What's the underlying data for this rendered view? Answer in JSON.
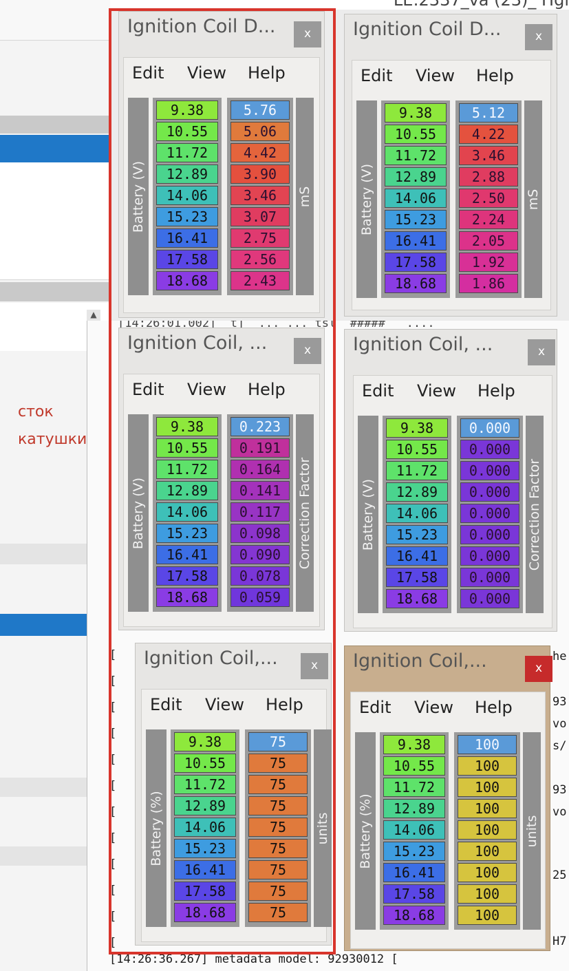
{
  "background": {
    "title_fragment": "LE:2337_va  (23)_ Hgl",
    "annotation_lines": [
      "сток",
      "катушки"
    ],
    "console_lines": [
      "[14:26:01.002]  t]  ... ... tsl  #####   ....",
      "[14:26:36.267] metadata model: 92930012 ["
    ],
    "console_right_fragments": [
      "he",
      "93",
      "vo",
      "s/",
      "93",
      "vo",
      "25",
      "H7"
    ],
    "console_left_marks": [
      "[",
      "[",
      "[",
      "[",
      "[",
      "[",
      "[",
      "[",
      "[",
      "[",
      "[",
      "["
    ]
  },
  "windows": [
    {
      "id": "w1",
      "title": "Ignition Coil D...",
      "close": "x",
      "menu": [
        "Edit",
        "View",
        "Help"
      ],
      "left_axis": "Battery (V)",
      "right_axis": "mS",
      "battery": [
        "9.38",
        "10.55",
        "11.72",
        "12.89",
        "14.06",
        "15.23",
        "16.41",
        "17.58",
        "18.68"
      ],
      "values": [
        "5.76",
        "5.06",
        "4.42",
        "3.90",
        "3.46",
        "3.07",
        "2.75",
        "2.56",
        "2.43"
      ],
      "value_colors": [
        "#5a9ad8",
        "#e07a3c",
        "#e4643c",
        "#e4503e",
        "#e24452",
        "#e03c60",
        "#e03a70",
        "#e0387c",
        "#dc348a"
      ]
    },
    {
      "id": "w2",
      "title": "Ignition Coil D...",
      "close": "x",
      "menu": [
        "Edit",
        "View",
        "Help"
      ],
      "left_axis": "Battery (V)",
      "right_axis": "mS",
      "battery": [
        "9.38",
        "10.55",
        "11.72",
        "12.89",
        "14.06",
        "15.23",
        "16.41",
        "17.58",
        "18.68"
      ],
      "values": [
        "5.12",
        "4.22",
        "3.46",
        "2.88",
        "2.50",
        "2.24",
        "2.05",
        "1.92",
        "1.86"
      ],
      "value_colors": [
        "#5a9ad8",
        "#e4523e",
        "#e2444e",
        "#e03c60",
        "#e0386e",
        "#de347c",
        "#dc328a",
        "#d83096",
        "#d42ea0"
      ]
    },
    {
      "id": "w3",
      "title": "Ignition Coil, ...",
      "close": "x",
      "menu": [
        "Edit",
        "View",
        "Help"
      ],
      "left_axis": "Battery (V)",
      "right_axis": "Correction Factor",
      "battery": [
        "9.38",
        "10.55",
        "11.72",
        "12.89",
        "14.06",
        "15.23",
        "16.41",
        "17.58",
        "18.68"
      ],
      "values": [
        "0.223",
        "0.191",
        "0.164",
        "0.141",
        "0.117",
        "0.098",
        "0.090",
        "0.078",
        "0.059"
      ],
      "value_colors": [
        "#5a9ad8",
        "#c0309c",
        "#b030b0",
        "#a432bc",
        "#9834c4",
        "#8c34cc",
        "#8436d2",
        "#7a36d8",
        "#7036dc"
      ]
    },
    {
      "id": "w4",
      "title": "Ignition Coil, ...",
      "close": "x",
      "menu": [
        "Edit",
        "View",
        "Help"
      ],
      "left_axis": "Battery (V)",
      "right_axis": "Correction Factor",
      "battery": [
        "9.38",
        "10.55",
        "11.72",
        "12.89",
        "14.06",
        "15.23",
        "16.41",
        "17.58",
        "18.68"
      ],
      "values": [
        "0.000",
        "0.000",
        "0.000",
        "0.000",
        "0.000",
        "0.000",
        "0.000",
        "0.000",
        "0.000"
      ],
      "value_colors": [
        "#5a9ad8",
        "#7a36d8",
        "#7a36d8",
        "#7a36d8",
        "#7a36d8",
        "#7a36d8",
        "#7a36d8",
        "#7a36d8",
        "#7a36d8"
      ]
    },
    {
      "id": "w5",
      "title": "Ignition Coil,...",
      "close": "x",
      "menu": [
        "Edit",
        "View",
        "Help"
      ],
      "left_axis": "Battery (%)",
      "right_axis": "units",
      "battery": [
        "9.38",
        "10.55",
        "11.72",
        "12.89",
        "14.06",
        "15.23",
        "16.41",
        "17.58",
        "18.68"
      ],
      "values": [
        "75",
        "75",
        "75",
        "75",
        "75",
        "75",
        "75",
        "75",
        "75"
      ],
      "value_colors": [
        "#5a9ad8",
        "#e07a3c",
        "#e07a3c",
        "#e07a3c",
        "#e07a3c",
        "#e07a3c",
        "#e07a3c",
        "#e07a3c",
        "#e07a3c"
      ]
    },
    {
      "id": "w6",
      "title": "Ignition Coil,...",
      "close": "x",
      "menu": [
        "Edit",
        "View",
        "Help"
      ],
      "left_axis": "Battery (%)",
      "right_axis": "units",
      "battery": [
        "9.38",
        "10.55",
        "11.72",
        "12.89",
        "14.06",
        "15.23",
        "16.41",
        "17.58",
        "18.68"
      ],
      "values": [
        "100",
        "100",
        "100",
        "100",
        "100",
        "100",
        "100",
        "100",
        "100"
      ],
      "value_colors": [
        "#5a9ad8",
        "#d6c43e",
        "#d6c43e",
        "#d6c43e",
        "#d6c43e",
        "#d6c43e",
        "#d6c43e",
        "#d6c43e",
        "#d6c43e"
      ]
    }
  ],
  "battery_colors": [
    "#8ee83c",
    "#74e84a",
    "#5ee26a",
    "#4ad48e",
    "#3ec0b8",
    "#3e9ce0",
    "#3c6ee6",
    "#5a46e6",
    "#8a3ce4"
  ],
  "accent": {
    "highlight_frame": "#d8352c",
    "close_active": "#c62b2b"
  }
}
